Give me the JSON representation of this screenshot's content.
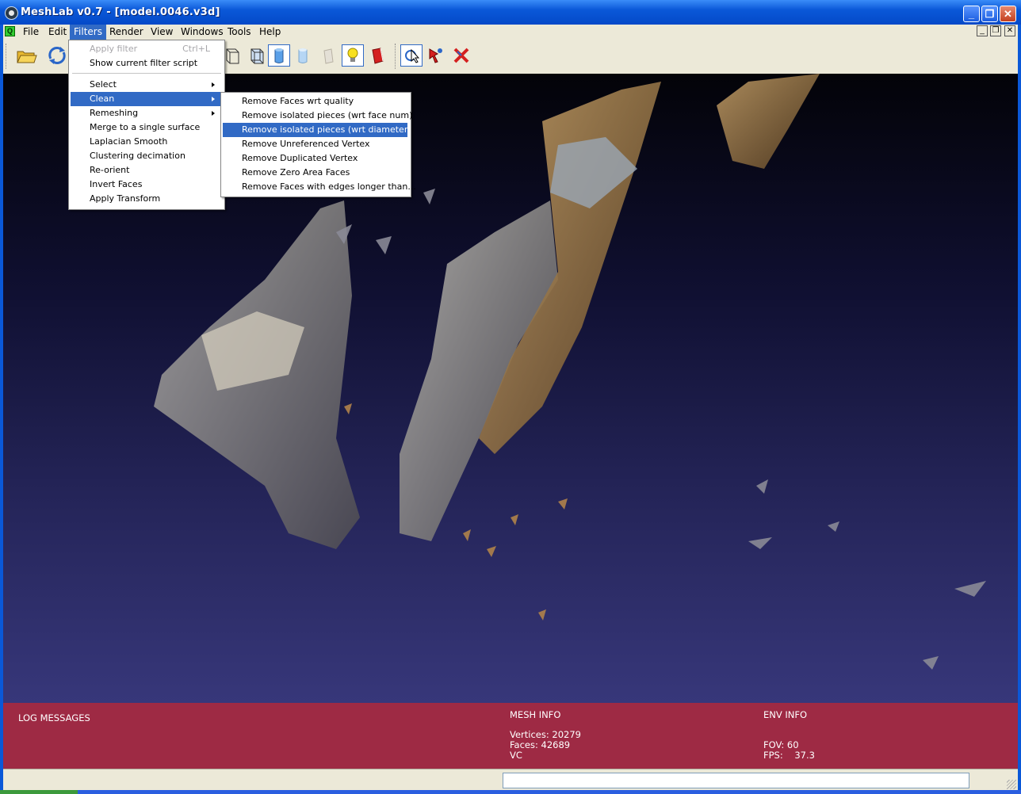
{
  "window": {
    "title": "MeshLab v0.7 - [model.0046.v3d]",
    "controls": {
      "minimize": "_",
      "restore": "❐",
      "close": "✕"
    }
  },
  "menubar": {
    "items": [
      {
        "label": "File"
      },
      {
        "label": "Edit"
      },
      {
        "label": "Filters"
      },
      {
        "label": "Render"
      },
      {
        "label": "View"
      },
      {
        "label": "Windows"
      },
      {
        "label": "Tools"
      },
      {
        "label": "Help"
      }
    ],
    "active": "Filters",
    "mdi_controls": {
      "minimize": "_",
      "restore": "❐",
      "close": "✕"
    }
  },
  "toolbar": {
    "icons": [
      "open-folder-icon",
      "reload-icon",
      "box-icon",
      "wireframe-icon",
      "hidden-lines-icon",
      "flat-shading-icon",
      "smooth-shading-icon",
      "texture-icon",
      "light-bulb-icon",
      "color-icon",
      "select-faces-icon",
      "paint-select-icon",
      "delete-selection-icon"
    ]
  },
  "filters_menu": {
    "items": [
      {
        "label": "Apply filter",
        "shortcut": "Ctrl+L",
        "disabled": true
      },
      {
        "label": "Show current filter script",
        "disabled": false
      },
      {
        "label": "Select",
        "submenu": true
      },
      {
        "label": "Clean",
        "submenu": true,
        "selected": true
      },
      {
        "label": "Remeshing",
        "submenu": true
      },
      {
        "label": "Merge to a single surface"
      },
      {
        "label": "Laplacian Smooth"
      },
      {
        "label": "Clustering decimation"
      },
      {
        "label": "Re-orient"
      },
      {
        "label": "Invert Faces"
      },
      {
        "label": "Apply Transform"
      }
    ]
  },
  "clean_submenu": {
    "items": [
      {
        "label": "Remove Faces wrt quality"
      },
      {
        "label": "Remove isolated pieces (wrt face num)"
      },
      {
        "label": "Remove isolated pieces (wrt diameter)",
        "selected": true
      },
      {
        "label": "Remove Unreferenced Vertex"
      },
      {
        "label": "Remove Duplicated Vertex"
      },
      {
        "label": "Remove Zero Area Faces"
      },
      {
        "label": "Remove Faces with edges longer than..."
      }
    ]
  },
  "info_panel": {
    "log_title": "LOG MESSAGES",
    "mesh_title": "MESH INFO",
    "vertices": "Vertices: 20279",
    "faces": "Faces: 42689",
    "vc": "VC",
    "env_title": "ENV INFO",
    "fov": "FOV: 60",
    "fps": "FPS:    37.3",
    "panel_color": "#9e2a44"
  },
  "statusbar": {
    "value": ""
  }
}
